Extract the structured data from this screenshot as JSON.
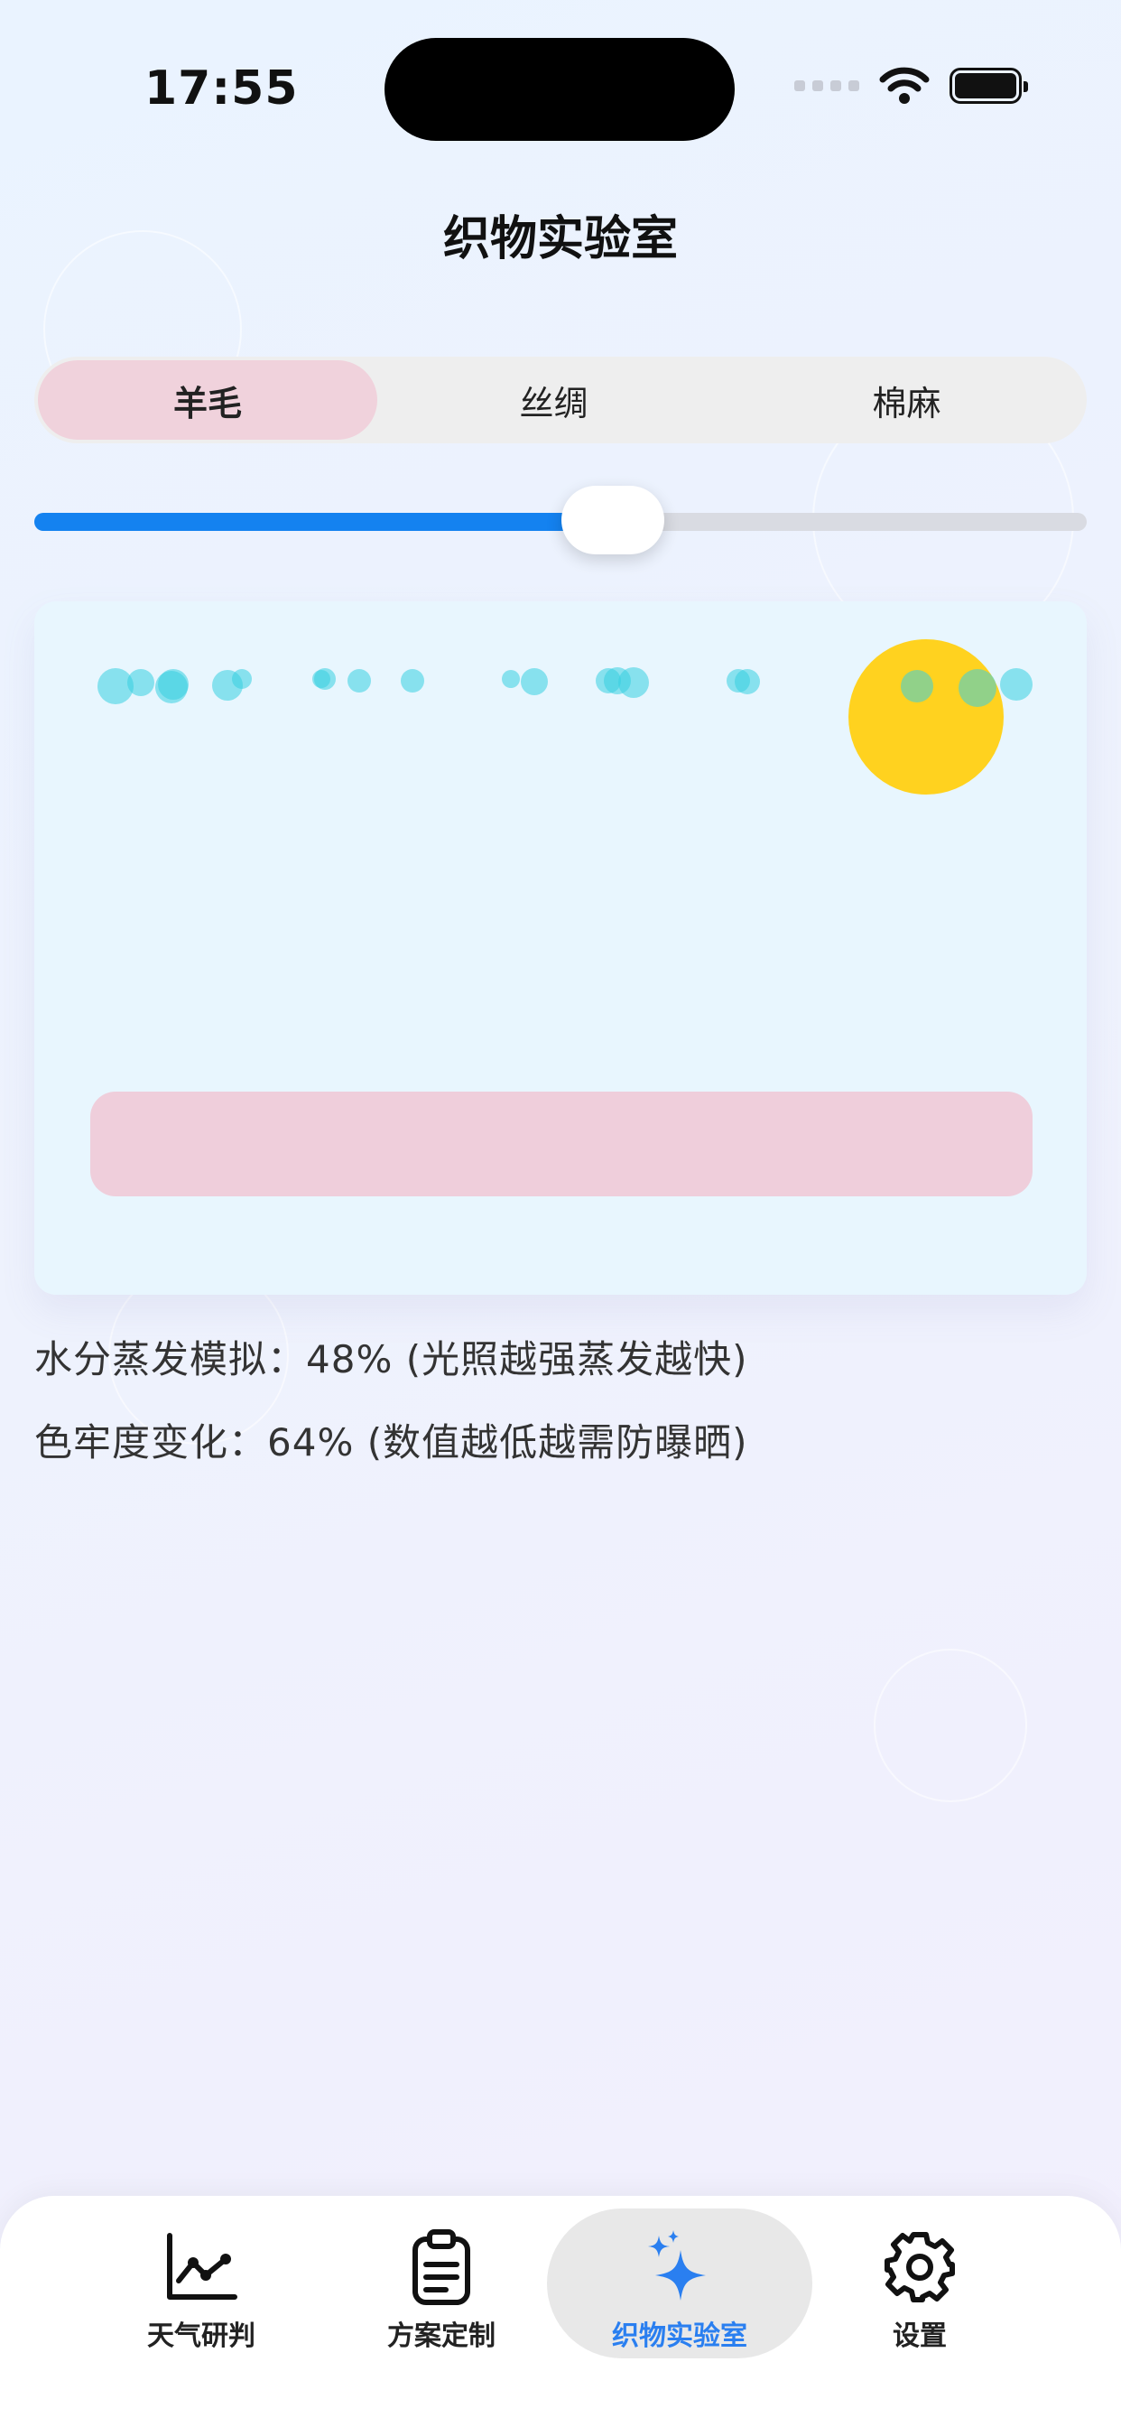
{
  "status_bar": {
    "time": "17:55"
  },
  "page": {
    "title": "织物实验室"
  },
  "fabric_selector": {
    "options": [
      "羊毛",
      "丝绸",
      "棉麻"
    ],
    "selected": "羊毛"
  },
  "light_slider": {
    "value_fraction": 0.55
  },
  "simulation": {
    "sun_color": "#ffd21f",
    "droplet_color": "#36cfe0",
    "fabric_color": "#efcedb"
  },
  "readouts": {
    "evaporation": "水分蒸发模拟：48% (光照越强蒸发越快)",
    "colorfastness": "色牢度变化：64% (数值越低越需防曝晒)"
  },
  "tabbar": {
    "items": [
      {
        "label": "天气研判",
        "icon": "line-chart-icon"
      },
      {
        "label": "方案定制",
        "icon": "clipboard-icon"
      },
      {
        "label": "织物实验室",
        "icon": "sparkles-icon"
      },
      {
        "label": "设置",
        "icon": "gear-icon"
      }
    ],
    "active_index": 2
  },
  "colors": {
    "accent": "#1482f0",
    "active_tab_label": "#2a7ff0"
  }
}
